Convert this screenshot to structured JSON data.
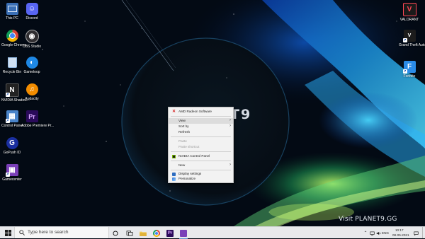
{
  "watermark": {
    "planet": "ET9",
    "visit": "Visit PLANET9.GG"
  },
  "desktop_icons": [
    {
      "id": "this-pc",
      "label": "This PC",
      "icon": "computer-icon",
      "color": "#3a6fb5"
    },
    {
      "id": "discord",
      "label": "Discord",
      "icon": "discord-icon",
      "color": "#5865f2"
    },
    {
      "id": "chrome",
      "label": "Google Chrome",
      "icon": "chrome-icon",
      "color": "#db4437"
    },
    {
      "id": "obs",
      "label": "OBS Studio",
      "icon": "obs-icon",
      "color": "#302e31"
    },
    {
      "id": "recycle-bin",
      "label": "Recycle Bin",
      "icon": "recycle-bin-icon",
      "color": "#8fb6e0"
    },
    {
      "id": "gameloop",
      "label": "Gameloop",
      "icon": "gameloop-icon",
      "color": "#1e88e5"
    },
    {
      "id": "nvidia",
      "label": "NVIDIA Shadow...",
      "icon": "nvidia-icon",
      "color": "#222222"
    },
    {
      "id": "audacity",
      "label": "Audacity",
      "icon": "audacity-icon",
      "color": "#f28c00"
    },
    {
      "id": "control-panel",
      "label": "Control Panel",
      "icon": "control-panel-icon",
      "color": "#4a84c9"
    },
    {
      "id": "premiere",
      "label": "Adobe Premiere Pr...",
      "icon": "premiere-icon",
      "color": "#2a0a5a"
    },
    {
      "id": "gopush",
      "label": "GoPush ID",
      "icon": "gopush-icon",
      "color": "#1a2fa0"
    },
    {
      "id": "gamecenter",
      "label": "Gamecenter",
      "icon": "gamecenter-icon",
      "color": "#7a3fb8"
    },
    {
      "id": "valorant",
      "label": "VALORANT",
      "icon": "valorant-icon",
      "color": "#ff4655"
    },
    {
      "id": "gta",
      "label": "Grand Theft Auto V",
      "icon": "gta-icon",
      "color": "#1c1c1c"
    },
    {
      "id": "fortnite",
      "label": "Fortnite",
      "icon": "fortnite-icon",
      "color": "#2a8be8"
    }
  ],
  "context_menu": {
    "items": [
      {
        "label": "AMD Radeon Software",
        "icon": "amd-radeon-icon",
        "icon_color": "#d62020",
        "enabled": true,
        "submenu": false
      },
      {
        "label": "View",
        "enabled": true,
        "submenu": true
      },
      {
        "label": "Sort by",
        "enabled": true,
        "submenu": true
      },
      {
        "label": "Refresh",
        "enabled": true,
        "submenu": false
      },
      {
        "label": "Paste",
        "enabled": false,
        "submenu": false
      },
      {
        "label": "Paste shortcut",
        "enabled": false,
        "submenu": false
      },
      {
        "label": "NVIDIA Control Panel",
        "icon": "nvidia-control-panel-icon",
        "icon_color": "#76b900",
        "enabled": true,
        "submenu": false
      },
      {
        "label": "New",
        "enabled": true,
        "submenu": true
      },
      {
        "label": "Display settings",
        "icon": "display-settings-icon",
        "icon_color": "#2d6cc0",
        "enabled": true,
        "submenu": false
      },
      {
        "label": "Personalize",
        "icon": "personalize-icon",
        "icon_color": "#3a7bd5",
        "enabled": true,
        "submenu": false
      }
    ],
    "submenu_arrow": "›"
  },
  "taskbar": {
    "search_placeholder": "Type here to search",
    "apps": [
      {
        "name": "task-view-icon"
      },
      {
        "name": "file-explorer-icon"
      },
      {
        "name": "store-icon"
      },
      {
        "name": "chrome-icon"
      },
      {
        "name": "premiere-icon",
        "label": "Pr"
      },
      {
        "name": "gamecenter-icon"
      }
    ],
    "tray": {
      "language": "ENG",
      "time": "10:17",
      "date": "08-05-2021"
    }
  }
}
